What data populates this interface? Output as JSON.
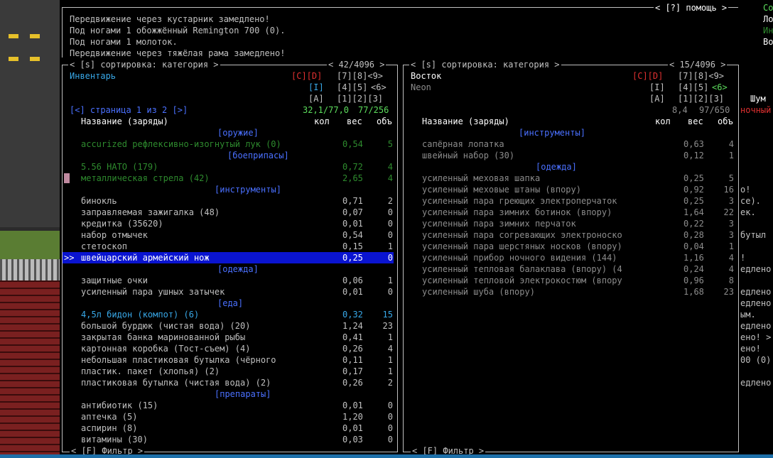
{
  "messages": {
    "help": "< [?] помощь >",
    "lines": [
      "Передвижение через кустарник замедлено!",
      "Под ногами 1 обожжённый Remington 700 (0).",
      "Под ногами 1 молоток.",
      "Передвижение через тяжёлая рама замедлено!"
    ]
  },
  "left": {
    "header_sort": "< [s] сортировка: категория >",
    "header_count": "< 42/4096 >",
    "title": "Инвентарь",
    "keys_row1_cd": "[C][D]",
    "keys_row1_num": "[7][8]<9>",
    "keys_row2_i": "[I]",
    "keys_row2_num_pre": "[4][5]",
    "keys_row2_num_post": "<6>",
    "keys_row3_a": "[A]",
    "keys_row3_num": "[1][2][3]",
    "page": "[<] страница 1 из 2 [>]",
    "weight": "32,1/77,0",
    "volume": "77/256",
    "col_name": "Название (заряды)",
    "col_qty": "кол",
    "col_wt": "вес",
    "col_vol": "объ",
    "filter": "< [F] Фильтр >",
    "rows": [
      {
        "name": "[оружие]",
        "wt": "",
        "vol": "",
        "kind": "cat"
      },
      {
        "name": "accurized рефлексивно-изогнутый лук (0)",
        "wt": "0,54",
        "vol": "5",
        "kind": "dgreen"
      },
      {
        "name": "[боеприпасы]",
        "wt": "",
        "vol": "",
        "kind": "cat"
      },
      {
        "name": "5.56 НАТО (179)",
        "wt": "0,72",
        "vol": "4",
        "kind": "dgreen"
      },
      {
        "name": "металлическая стрела (42)",
        "wt": "2,65",
        "vol": "4",
        "kind": "dgreen"
      },
      {
        "name": "[инструменты]",
        "wt": "",
        "vol": "",
        "kind": "cat"
      },
      {
        "name": "бинокль",
        "wt": "0,71",
        "vol": "2",
        "kind": "gray"
      },
      {
        "name": "заправляемая зажигалка (48)",
        "wt": "0,07",
        "vol": "0",
        "kind": "gray"
      },
      {
        "name": "кредитка (35620)",
        "wt": "0,01",
        "vol": "0",
        "kind": "gray"
      },
      {
        "name": "набор отмычек",
        "wt": "0,54",
        "vol": "0",
        "kind": "gray"
      },
      {
        "name": "стетоскоп",
        "wt": "0,15",
        "vol": "1",
        "kind": "gray"
      },
      {
        "name": "швейцарский армейский нож",
        "wt": "0,25",
        "vol": "0",
        "kind": "sel"
      },
      {
        "name": "[одежда]",
        "wt": "",
        "vol": "",
        "kind": "cat"
      },
      {
        "name": "защитные очки",
        "wt": "0,06",
        "vol": "1",
        "kind": "gray"
      },
      {
        "name": "усиленный пара ушных затычек",
        "wt": "0,01",
        "vol": "0",
        "kind": "gray"
      },
      {
        "name": "[еда]",
        "wt": "",
        "vol": "",
        "kind": "cat"
      },
      {
        "name": "4,5л бидон (компот) (6)",
        "wt": "0,32",
        "vol": "15",
        "kind": "cyan"
      },
      {
        "name": "большой бурдюк (чистая вода) (20)",
        "wt": "1,24",
        "vol": "23",
        "kind": "gray"
      },
      {
        "name": "закрытая банка маринованной рыбы",
        "wt": "0,41",
        "vol": "1",
        "kind": "gray"
      },
      {
        "name": "картонная коробка (Тост-съем) (4)",
        "wt": "0,26",
        "vol": "4",
        "kind": "gray"
      },
      {
        "name": "небольшая пластиковая бутылка (чёрного",
        "wt": "0,11",
        "vol": "1",
        "kind": "gray"
      },
      {
        "name": "пластик. пакет (хлопья) (2)",
        "wt": "0,17",
        "vol": "1",
        "kind": "gray"
      },
      {
        "name": "пластиковая бутылка (чистая вода) (2)",
        "wt": "0,26",
        "vol": "2",
        "kind": "gray"
      },
      {
        "name": "[препараты]",
        "wt": "",
        "vol": "",
        "kind": "cat"
      },
      {
        "name": "антибиотик (15)",
        "wt": "0,01",
        "vol": "0",
        "kind": "gray"
      },
      {
        "name": "аптечка (5)",
        "wt": "1,20",
        "vol": "0",
        "kind": "gray"
      },
      {
        "name": "аспирин (8)",
        "wt": "0,01",
        "vol": "0",
        "kind": "gray"
      },
      {
        "name": "витамины (30)",
        "wt": "0,03",
        "vol": "0",
        "kind": "gray"
      }
    ]
  },
  "right": {
    "header_sort": "< [s] сортировка: категория >",
    "header_count": "< 15/4096 >",
    "title": "Восток",
    "subtitle": "Neon",
    "keys_row1_cd": "[C][D]",
    "keys_row1_num": "[7][8]<9>",
    "keys_row2_i": "[I]",
    "keys_row2_num_pre": "[4][5]",
    "keys_row2_num_post": "<6>",
    "keys_row3_a": "[A]",
    "keys_row3_num": "[1][2][3]",
    "weight": "8,4",
    "volume": "97/650",
    "col_name": "Название (заряды)",
    "col_qty": "кол",
    "col_wt": "вес",
    "col_vol": "объ",
    "filter": "< [F] Фильтр >",
    "rows": [
      {
        "name": "[инструменты]",
        "wt": "",
        "vol": "",
        "kind": "cat"
      },
      {
        "name": "сапёрная лопатка",
        "wt": "0,63",
        "vol": "4",
        "kind": "dim"
      },
      {
        "name": "швейный набор (30)",
        "wt": "0,12",
        "vol": "1",
        "kind": "dim"
      },
      {
        "name": "[одежда]",
        "wt": "",
        "vol": "",
        "kind": "cat"
      },
      {
        "name": "усиленный меховая шапка",
        "wt": "0,25",
        "vol": "5",
        "kind": "dim"
      },
      {
        "name": "усиленный меховые штаны (впору)",
        "wt": "0,92",
        "vol": "16",
        "kind": "dim"
      },
      {
        "name": "усиленный пара греющих электроперчаток",
        "wt": "0,25",
        "vol": "3",
        "kind": "dim"
      },
      {
        "name": "усиленный пара зимних ботинок (впору)",
        "wt": "1,64",
        "vol": "22",
        "kind": "dim"
      },
      {
        "name": "усиленный пара зимних перчаток",
        "wt": "0,22",
        "vol": "3",
        "kind": "dim"
      },
      {
        "name": "усиленный пара согревающих электроноско",
        "wt": "0,28",
        "vol": "3",
        "kind": "dim"
      },
      {
        "name": "усиленный пара шерстяных носков (впору)",
        "wt": "0,04",
        "vol": "1",
        "kind": "dim"
      },
      {
        "name": "усиленный прибор ночного видения (144)",
        "wt": "1,16",
        "vol": "4",
        "kind": "dim"
      },
      {
        "name": "усиленный тепловая балаклава (впору) (4",
        "wt": "0,24",
        "vol": "4",
        "kind": "dim"
      },
      {
        "name": "усиленный тепловой электрокостюм (впору",
        "wt": "0,96",
        "vol": "8",
        "kind": "dim"
      },
      {
        "name": "усиленный шуба (впору)",
        "wt": "1,68",
        "vol": "23",
        "kind": "dim"
      }
    ]
  },
  "sidebar": {
    "top": [
      "Со",
      "Ло",
      "Ин",
      "Во"
    ],
    "noise_label": "Шум",
    "noise_value": "ночный",
    "log": [
      "о!",
      "се).",
      "ек.",
      "",
      "бутыл",
      "",
      "!",
      "едлено",
      "",
      "едлено",
      "едлено",
      "ым.",
      "едлено",
      "ено! >",
      "ено!",
      "00 (0)",
      "",
      "едлено"
    ]
  },
  "colors": {
    "selection": "#0a14d0",
    "category": "#4a70ff",
    "good": "#3cb043",
    "warning": "#e03030",
    "info": "#38a8e8"
  }
}
